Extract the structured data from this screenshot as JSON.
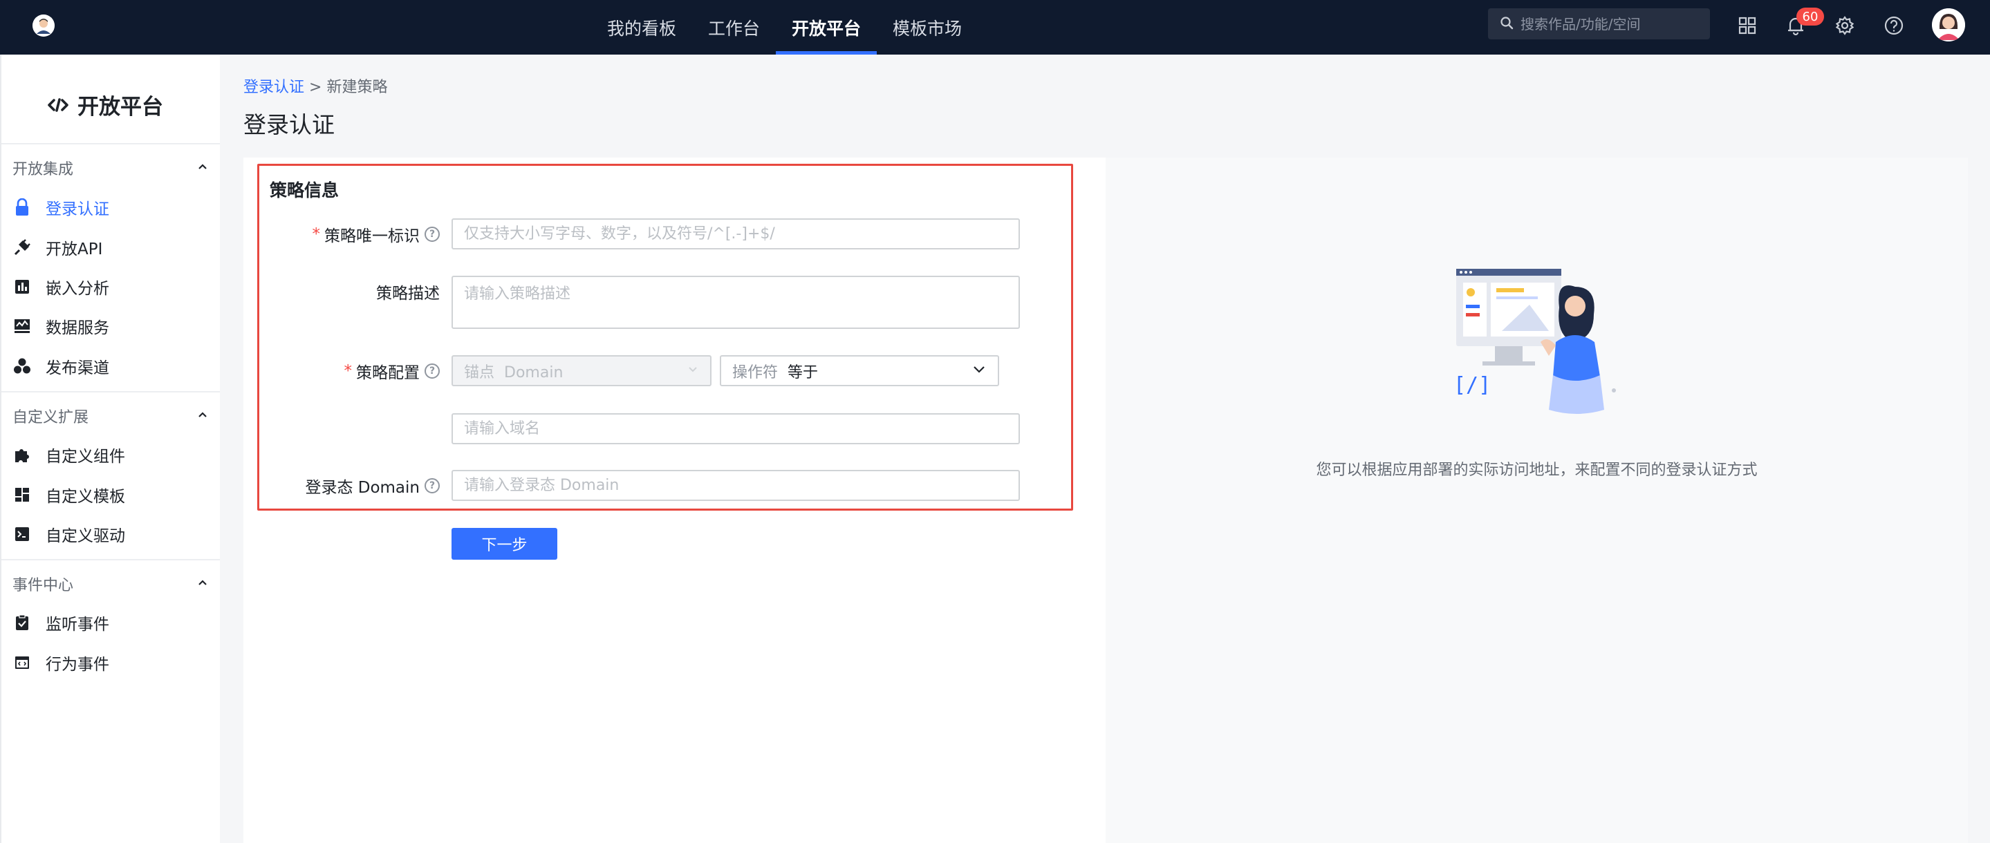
{
  "topbar": {
    "nav": [
      {
        "label": "我的看板",
        "active": false
      },
      {
        "label": "工作台",
        "active": false
      },
      {
        "label": "开放平台",
        "active": true
      },
      {
        "label": "模板市场",
        "active": false
      }
    ],
    "search_placeholder": "搜索作品/功能/空间",
    "notification_count": "60",
    "icons": [
      "grid-icon",
      "bell-icon",
      "gear-icon",
      "help-circle-icon"
    ]
  },
  "sidebar": {
    "brand": "开放平台",
    "sections": [
      {
        "title": "开放集成",
        "items": [
          {
            "label": "登录认证",
            "icon": "lock-icon",
            "active": true
          },
          {
            "label": "开放API",
            "icon": "plug-icon",
            "active": false
          },
          {
            "label": "嵌入分析",
            "icon": "bar-chart-icon",
            "active": false
          },
          {
            "label": "数据服务",
            "icon": "data-monitor-icon",
            "active": false
          },
          {
            "label": "发布渠道",
            "icon": "channels-icon",
            "active": false
          }
        ]
      },
      {
        "title": "自定义扩展",
        "items": [
          {
            "label": "自定义组件",
            "icon": "puzzle-icon",
            "active": false
          },
          {
            "label": "自定义模板",
            "icon": "template-icon",
            "active": false
          },
          {
            "label": "自定义驱动",
            "icon": "terminal-icon",
            "active": false
          }
        ]
      },
      {
        "title": "事件中心",
        "items": [
          {
            "label": "监听事件",
            "icon": "clipboard-check-icon",
            "active": false
          },
          {
            "label": "行为事件",
            "icon": "code-window-icon",
            "active": false
          }
        ]
      }
    ]
  },
  "breadcrumb": {
    "parent": "登录认证",
    "separator": ">",
    "current": "新建策略"
  },
  "page_title": "登录认证",
  "form": {
    "section_title": "策略信息",
    "strategy_id": {
      "label": "策略唯一标识",
      "required": true,
      "placeholder": "仅支持大小写字母、数字，以及符号/^[.-]+$/"
    },
    "strategy_desc": {
      "label": "策略描述",
      "required": false,
      "placeholder": "请输入策略描述"
    },
    "strategy_config": {
      "label": "策略配置",
      "required": true,
      "anchor_prefix": "锚点",
      "anchor_value": "Domain",
      "operator_prefix": "操作符",
      "operator_value": "等于",
      "domain_placeholder": "请输入域名"
    },
    "login_domain": {
      "label": "登录态 Domain",
      "required": false,
      "placeholder": "请输入登录态 Domain"
    },
    "next_button": "下一步"
  },
  "right_panel": {
    "caption": "您可以根据应用部署的实际访问地址，来配置不同的登录认证方式"
  },
  "colors": {
    "primary": "#3370ff",
    "topbar": "#0f1a2e",
    "highlight": "#e8483f",
    "badge": "#f54a45"
  }
}
